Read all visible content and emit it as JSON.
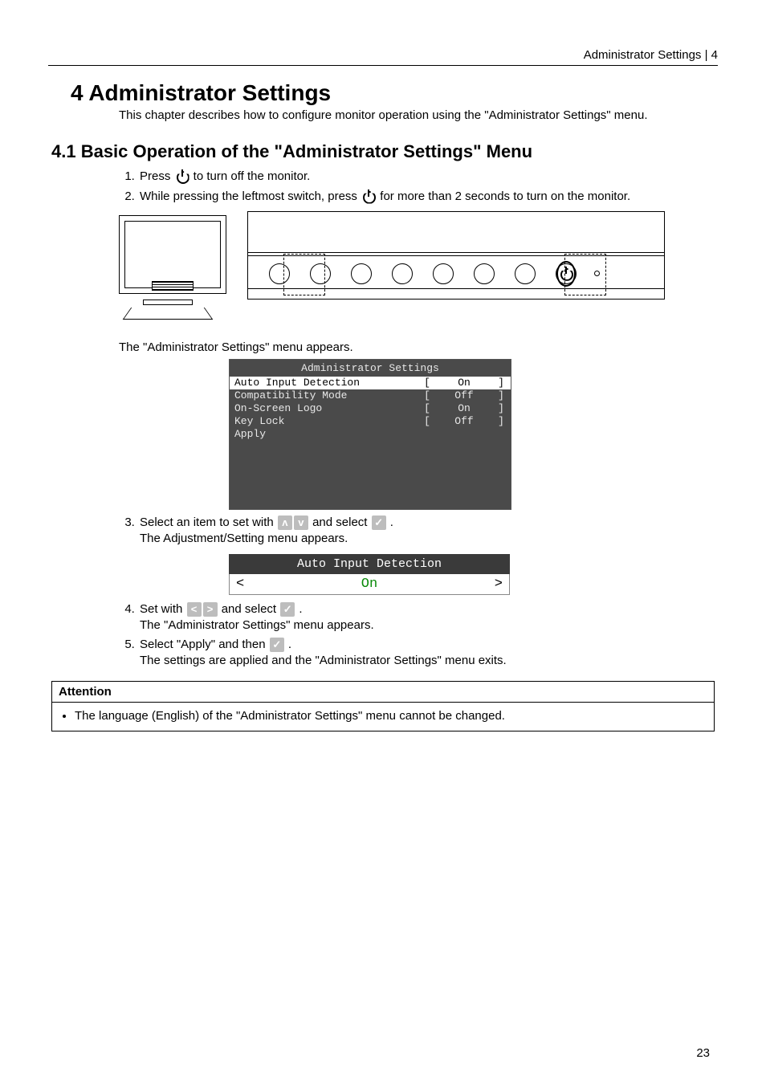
{
  "header": {
    "text": "Administrator Settings  |  4"
  },
  "h1": "4 Administrator Settings",
  "intro": "This chapter describes how to configure monitor operation using the \"Administrator Settings\" menu.",
  "h2": "4.1 Basic Operation of the \"Administrator Settings\" Menu",
  "steps": {
    "s1_a": "Press ",
    "s1_b": " to turn off the monitor.",
    "s2_a": "While pressing the leftmost switch, press ",
    "s2_b": " for more than 2 seconds to turn on the monitor.",
    "after2": "The \"Administrator Settings\" menu appears.",
    "s3_a": "Select an item to set with ",
    "s3_b": " and select ",
    "s3_c": " .",
    "after3": "The Adjustment/Setting menu appears.",
    "s4_a": "Set with ",
    "s4_b": " and select ",
    "s4_c": " .",
    "after4": "The \"Administrator Settings\" menu appears.",
    "s5_a": "Select \"Apply\" and then ",
    "s5_b": " .",
    "after5": "The settings are applied and the \"Administrator Settings\" menu exits."
  },
  "osd": {
    "title": "Administrator Settings",
    "rows": [
      {
        "label": "Auto Input Detection",
        "value": "On",
        "selected": true
      },
      {
        "label": "Compatibility Mode",
        "value": "Off",
        "selected": false
      },
      {
        "label": "On-Screen Logo",
        "value": "On",
        "selected": false
      },
      {
        "label": "Key Lock",
        "value": "Off",
        "selected": false
      },
      {
        "label": "Apply",
        "value": "",
        "selected": false
      }
    ]
  },
  "subosd": {
    "title": "Auto Input Detection",
    "left": "<",
    "value": "On",
    "right": ">"
  },
  "icons": {
    "up": "ʌ",
    "down": "v",
    "left": "<",
    "right": ">",
    "check": "✓"
  },
  "attention": {
    "title": "Attention",
    "item": "The language (English) of the \"Administrator Settings\" menu cannot be changed."
  },
  "pageNumber": "23"
}
